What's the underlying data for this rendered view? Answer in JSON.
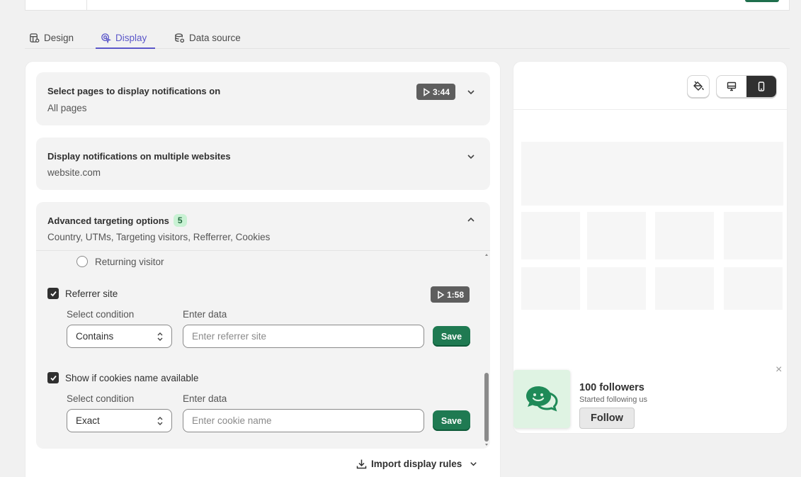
{
  "tabs": [
    {
      "label": "Design",
      "icon": "design-icon"
    },
    {
      "label": "Display",
      "icon": "display-icon",
      "active": true
    },
    {
      "label": "Data source",
      "icon": "database-icon"
    }
  ],
  "pages_card": {
    "title": "Select pages to display notifications on",
    "subtitle": "All pages",
    "video": "3:44"
  },
  "websites_card": {
    "title": "Display notifications on multiple websites",
    "subtitle": "website.com"
  },
  "advanced_card": {
    "title": "Advanced targeting options",
    "count": "5",
    "subtitle": "Country, UTMs, Targeting visitors, Refferrer, Cookies"
  },
  "returning_visitor": {
    "label": "Returning visitor"
  },
  "referrer": {
    "label": "Referrer site",
    "video": "1:58",
    "condition_label": "Select condition",
    "condition_value": "Contains",
    "data_label": "Enter data",
    "placeholder": "Enter referrer site",
    "save": "Save"
  },
  "cookies": {
    "label": "Show if cookies name available",
    "condition_label": "Select condition",
    "condition_value": "Exact",
    "data_label": "Enter data",
    "placeholder": "Enter cookie name",
    "save": "Save"
  },
  "import_rules": "Import display rules",
  "preview": {
    "notification": {
      "title": "100 followers",
      "subtitle": "Started following us",
      "button": "Follow",
      "close": "×"
    }
  },
  "colors": {
    "accent": "#5b57c9",
    "primary_button": "#1f7a52",
    "count_badge": "#c9f2d4"
  }
}
